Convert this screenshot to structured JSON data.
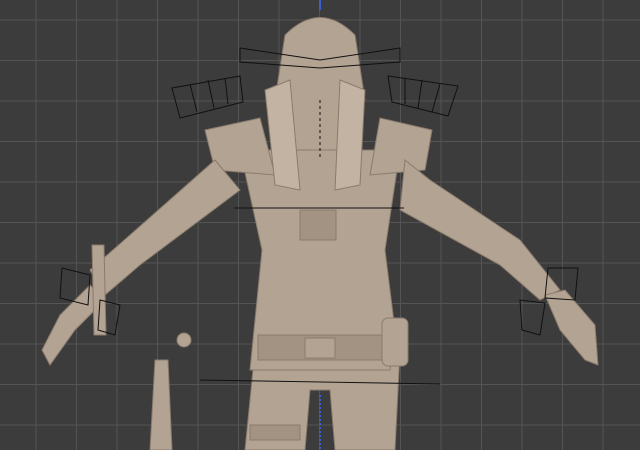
{
  "viewport": {
    "background_color": "#3c3c3c",
    "grid_color": "#545454",
    "model_color": "#b3a393",
    "model_shadow_color": "#8a7b6d",
    "gizmo_color": "#111111",
    "axis_color": "#3a5fd0"
  }
}
